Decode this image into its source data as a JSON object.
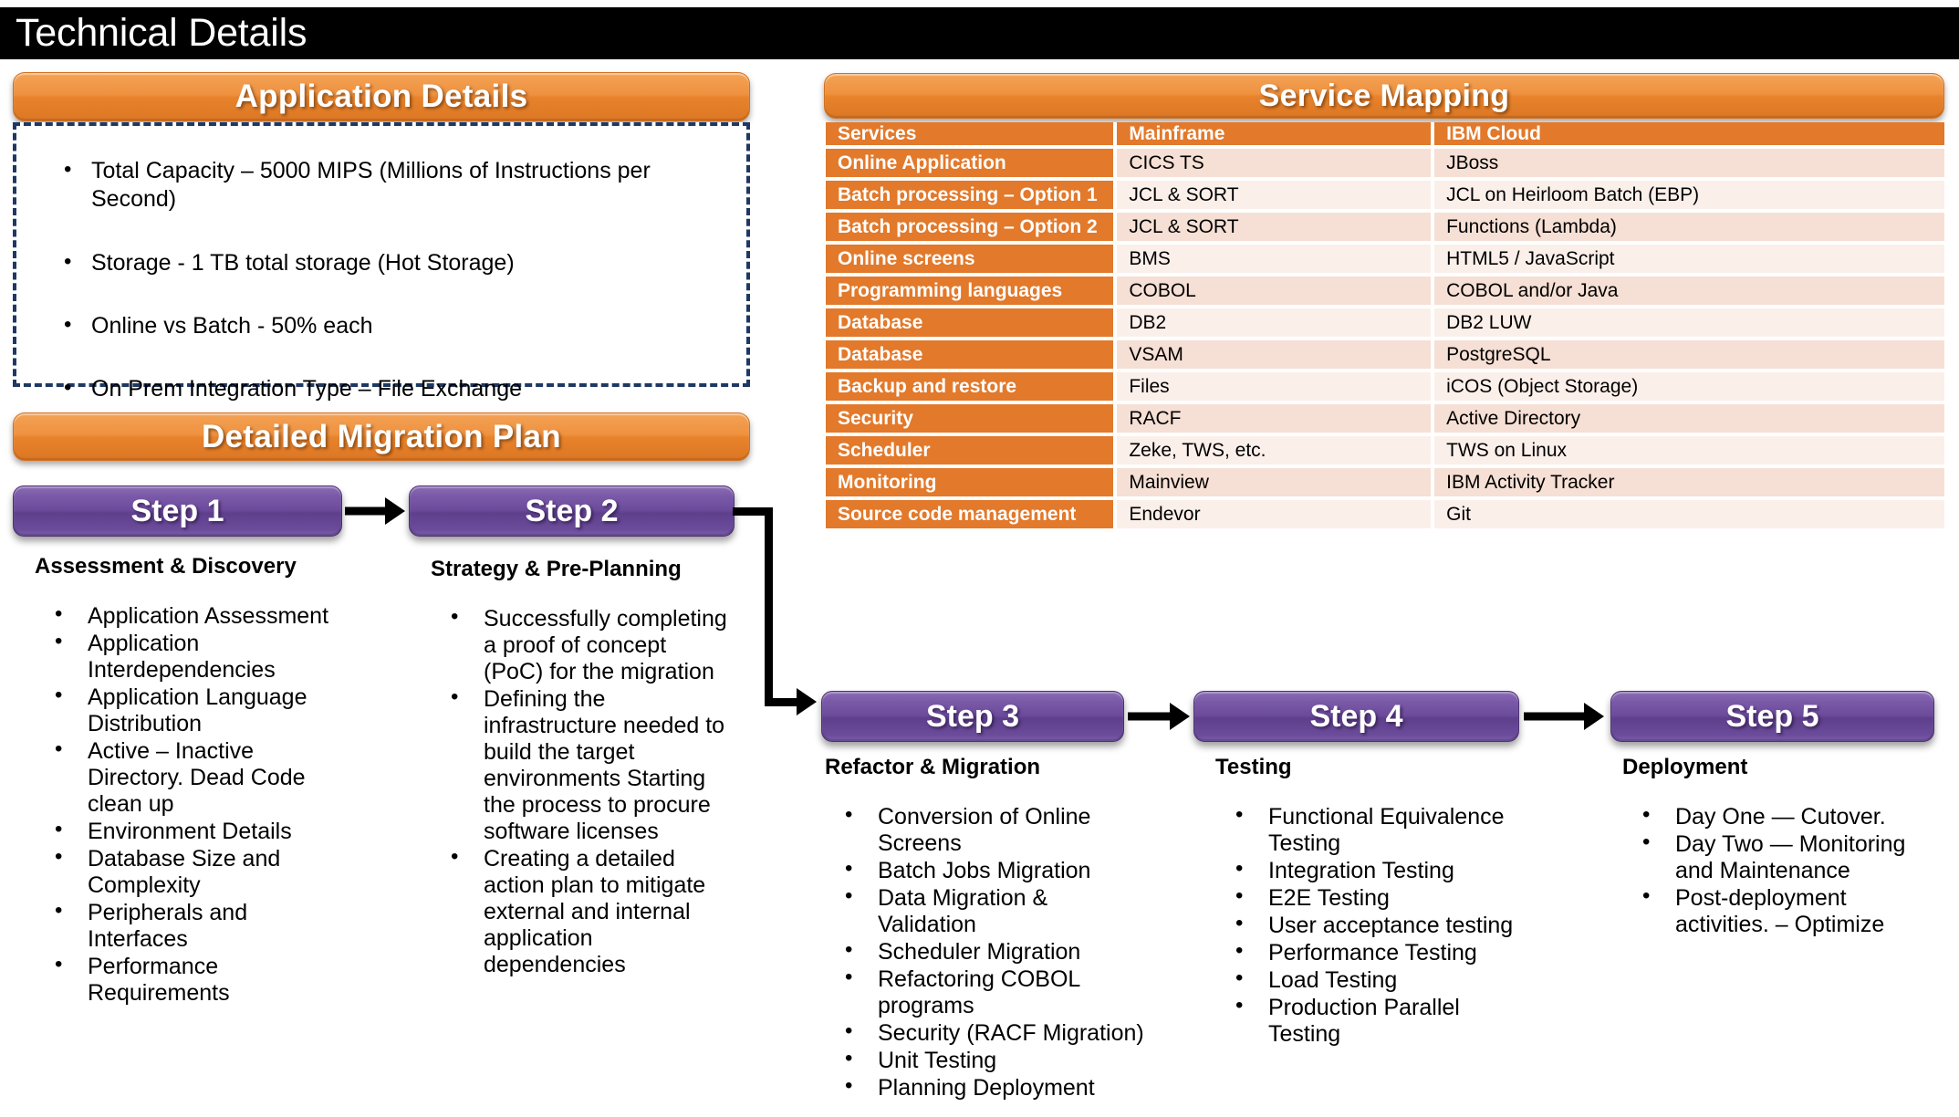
{
  "page": {
    "title": "Technical Details",
    "title_bg": "#000000",
    "accent_orange": "#E2792B",
    "accent_purple": "#6C4B9C",
    "dashed_border_color": "#1F3864"
  },
  "application_details": {
    "banner_label": "Application Details",
    "bullets": [
      "Total Capacity – 5000 MIPS (Millions of Instructions per Second)",
      "Storage - 1 TB total storage (Hot Storage)",
      "Online vs Batch - 50% each",
      "On Prem Integration Type – File Exchange"
    ]
  },
  "service_mapping": {
    "banner_label": "Service Mapping",
    "columns": [
      "Services",
      "Mainframe",
      "IBM Cloud"
    ],
    "rows": [
      {
        "service": "Online Application",
        "mainframe": "CICS TS",
        "ibm_cloud": "JBoss"
      },
      {
        "service": "Batch processing – Option 1",
        "mainframe": "JCL & SORT",
        "ibm_cloud": "JCL on Heirloom Batch (EBP)"
      },
      {
        "service": "Batch processing – Option 2",
        "mainframe": "JCL & SORT",
        "ibm_cloud": "Functions (Lambda)"
      },
      {
        "service": "Online screens",
        "mainframe": "BMS",
        "ibm_cloud": "HTML5 / JavaScript"
      },
      {
        "service": "Programming languages",
        "mainframe": "COBOL",
        "ibm_cloud": "COBOL and/or Java"
      },
      {
        "service": "Database",
        "mainframe": "DB2",
        "ibm_cloud": "DB2 LUW"
      },
      {
        "service": "Database",
        "mainframe": "VSAM",
        "ibm_cloud": "PostgreSQL"
      },
      {
        "service": "Backup and restore",
        "mainframe": "Files",
        "ibm_cloud": "iCOS (Object Storage)"
      },
      {
        "service": "Security",
        "mainframe": "RACF",
        "ibm_cloud": "Active Directory"
      },
      {
        "service": "Scheduler",
        "mainframe": "Zeke, TWS, etc.",
        "ibm_cloud": "TWS on Linux"
      },
      {
        "service": "Monitoring",
        "mainframe": "Mainview",
        "ibm_cloud": "IBM Activity Tracker"
      },
      {
        "service": "Source code management",
        "mainframe": "Endevor",
        "ibm_cloud": "Git"
      }
    ]
  },
  "migration_plan": {
    "banner_label": "Detailed Migration Plan",
    "steps": [
      {
        "pill": "Step 1",
        "subtitle": "Assessment & Discovery",
        "bullets": [
          "Application Assessment",
          "Application Interdependencies",
          "Application Language Distribution",
          "Active – Inactive Directory. Dead Code clean up",
          "Environment Details",
          "Database Size and Complexity",
          "Peripherals and Interfaces",
          "Performance Requirements"
        ]
      },
      {
        "pill": "Step 2",
        "subtitle": "Strategy & Pre-Planning",
        "bullets": [
          "Successfully completing a proof of concept (PoC) for the migration",
          "Defining the infrastructure needed to build the target environments Starting the process to procure software licenses",
          "Creating a detailed action plan to mitigate external and internal application dependencies"
        ]
      },
      {
        "pill": "Step 3",
        "subtitle": "Refactor & Migration",
        "bullets": [
          "Conversion of Online Screens",
          "Batch Jobs Migration",
          "Data Migration & Validation",
          "Scheduler Migration",
          "Refactoring COBOL programs",
          "Security (RACF Migration)",
          "Unit Testing",
          "Planning Deployment"
        ]
      },
      {
        "pill": "Step 4",
        "subtitle": "Testing",
        "bullets": [
          "Functional Equivalence Testing",
          "Integration Testing",
          "E2E Testing",
          "User acceptance testing",
          "Performance Testing",
          "Load Testing",
          "Production Parallel Testing"
        ]
      },
      {
        "pill": "Step 5",
        "subtitle": "Deployment",
        "bullets": [
          "Day One — Cutover.",
          "Day Two — Monitoring and Maintenance",
          "Post-deployment activities. – Optimize"
        ]
      }
    ]
  }
}
